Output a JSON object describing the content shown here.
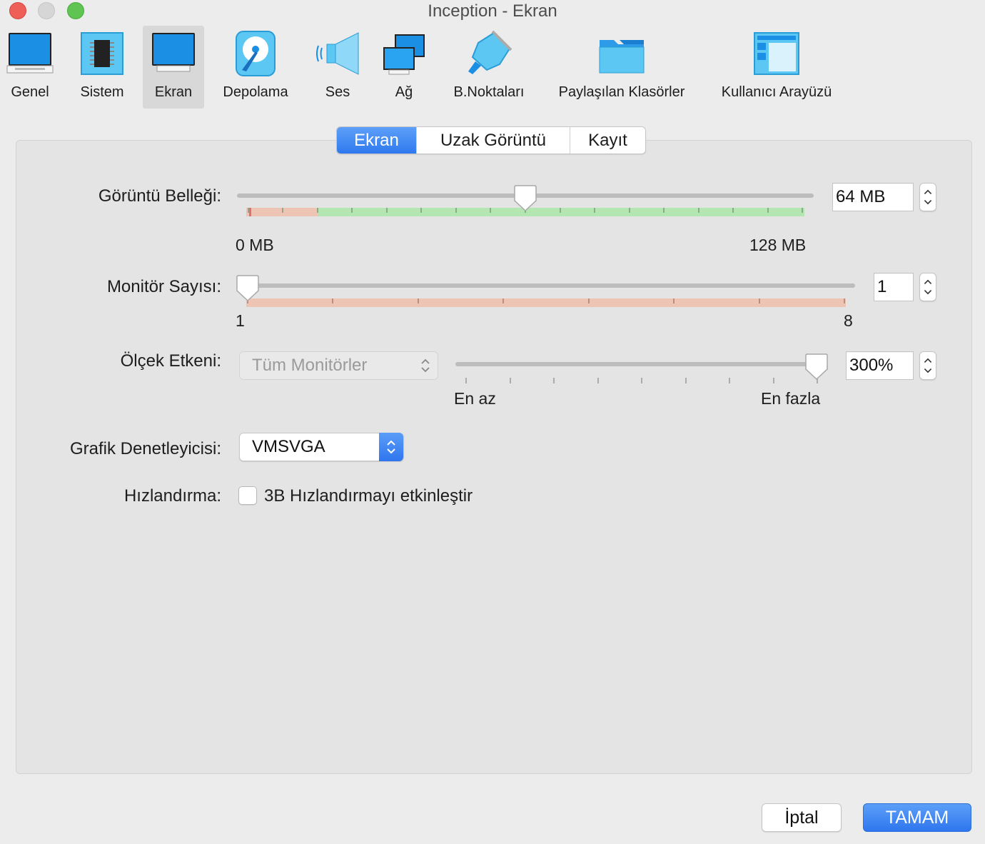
{
  "window": {
    "title": "Inception - Ekran"
  },
  "toolbar": {
    "items": [
      {
        "label": "Genel",
        "icon": "monitor-general-icon"
      },
      {
        "label": "Sistem",
        "icon": "chip-icon"
      },
      {
        "label": "Ekran",
        "icon": "display-icon",
        "selected": true
      },
      {
        "label": "Depolama",
        "icon": "hard-disk-icon"
      },
      {
        "label": "Ses",
        "icon": "speaker-icon"
      },
      {
        "label": "Ağ",
        "icon": "network-icon"
      },
      {
        "label": "B.Noktaları",
        "icon": "plug-icon"
      },
      {
        "label": "Paylaşılan Klasörler",
        "icon": "folder-icon"
      },
      {
        "label": "Kullanıcı Arayüzü",
        "icon": "window-layout-icon"
      }
    ]
  },
  "tabs": [
    {
      "label": "Ekran",
      "active": true
    },
    {
      "label": "Uzak Görüntü",
      "active": false
    },
    {
      "label": "Kayıt",
      "active": false
    }
  ],
  "video_memory": {
    "label": "Görüntü Belleği:",
    "value": "64 MB",
    "min_label": "0 MB",
    "max_label": "128 MB",
    "level": 0.5
  },
  "monitor_count": {
    "label": "Monitör Sayısı:",
    "value": "1",
    "min_label": "1",
    "max_label": "8",
    "level": 0
  },
  "scale_factor": {
    "label": "Ölçek Etkeni:",
    "monitor_select": "Tüm Monitörler",
    "value": "300%",
    "min_label": "En az",
    "max_label": "En fazla",
    "level": 1
  },
  "graphics_controller": {
    "label": "Grafik Denetleyicisi:",
    "value": "VMSVGA"
  },
  "acceleration": {
    "label": "Hızlandırma:",
    "checkbox_label": "3B Hızlandırmayı etkinleştir",
    "checked": false
  },
  "buttons": {
    "cancel": "İptal",
    "ok": "TAMAM"
  },
  "colors": {
    "accent": "#2f76ee",
    "ok_range": "#b3e6b1",
    "warn_range": "#eec4b4"
  }
}
